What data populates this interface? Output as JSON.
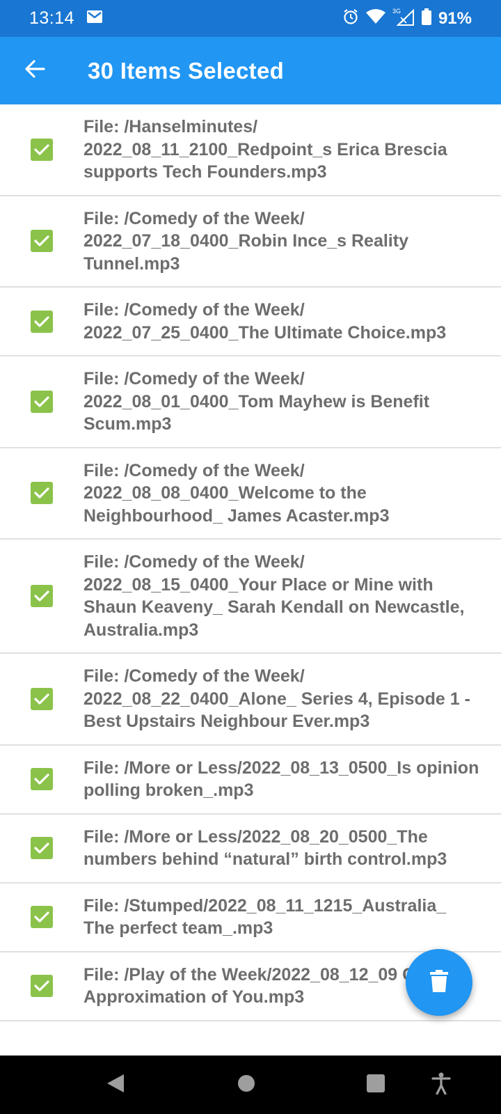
{
  "status_bar": {
    "time": "13:14",
    "battery": "91%",
    "icons": [
      "mail-icon",
      "alarm-icon",
      "wifi-icon",
      "signal-3g-icon",
      "battery-icon"
    ]
  },
  "app_bar": {
    "title": "30 Items Selected",
    "back_icon": "arrow-left-icon"
  },
  "colors": {
    "status_bar": "#1976d2",
    "app_bar": "#2196f3",
    "checkbox": "#8bc34a",
    "item_text": "#6d6d6d",
    "fab": "#2196f3"
  },
  "items": [
    {
      "label": "File: /Hanselminutes/ 2022_08_11_2100_Redpoint_s Erica Brescia supports Tech Founders.mp3",
      "checked": true
    },
    {
      "label": "File: /Comedy of the Week/ 2022_07_18_0400_Robin Ince_s Reality Tunnel.mp3",
      "checked": true
    },
    {
      "label": "File: /Comedy of the Week/ 2022_07_25_0400_The Ultimate Choice.mp3",
      "checked": true
    },
    {
      "label": "File: /Comedy of the Week/ 2022_08_01_0400_Tom Mayhew is Benefit Scum.mp3",
      "checked": true
    },
    {
      "label": "File: /Comedy of the Week/ 2022_08_08_0400_Welcome to the Neighbourhood_ James Acaster.mp3",
      "checked": true
    },
    {
      "label": "File: /Comedy of the Week/ 2022_08_15_0400_Your Place or Mine with Shaun Keaveny_ Sarah Kendall on Newcastle, Australia.mp3",
      "checked": true
    },
    {
      "label": "File: /Comedy of the Week/ 2022_08_22_0400_Alone_ Series 4, Episode 1 - Best Upstairs Neighbour Ever.mp3",
      "checked": true
    },
    {
      "label": "File: /More or Less/2022_08_13_0500_Is opinion polling broken_.mp3",
      "checked": true
    },
    {
      "label": "File: /More or Less/2022_08_20_0500_The numbers behind “natural” birth control.mp3",
      "checked": true
    },
    {
      "label": "File: /Stumped/2022_08_11_1215_Australia_ The perfect team_.mp3",
      "checked": true
    },
    {
      "label": "File: /Play of the Week/2022_08_12_09 Close Approximation of You.mp3",
      "checked": true
    }
  ],
  "fab": {
    "icon": "trash-icon"
  },
  "nav_bar": {
    "icons": [
      "back-triangle-icon",
      "home-circle-icon",
      "recents-square-icon",
      "accessibility-icon"
    ]
  }
}
